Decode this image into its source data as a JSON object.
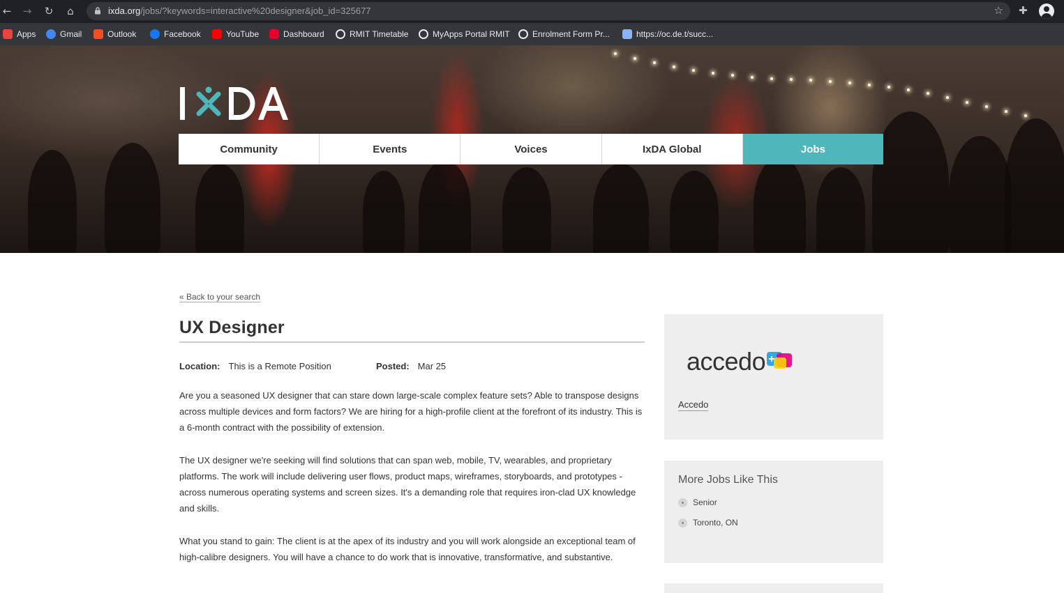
{
  "browser": {
    "url_host": "ixda.org",
    "url_rest": "/jobs/?keywords=interactive%20designer&job_id=325677",
    "bookmarks": [
      {
        "label": "Apps",
        "icon": "apps-grid-icon",
        "color": "#e8453c"
      },
      {
        "label": "Gmail",
        "icon": "google-icon",
        "color": "#4285f4"
      },
      {
        "label": "Outlook",
        "icon": "windows-icon",
        "color": "#f25022"
      },
      {
        "label": "Facebook",
        "icon": "facebook-icon",
        "color": "#1877f2"
      },
      {
        "label": "YouTube",
        "icon": "youtube-icon",
        "color": "#ff0000"
      },
      {
        "label": "Dashboard",
        "icon": "dashboard-icon",
        "color": "#e4002b"
      },
      {
        "label": "RMIT Timetable",
        "icon": "globe-icon",
        "color": "#e8eaed"
      },
      {
        "label": "MyApps Portal RMIT",
        "icon": "globe-icon",
        "color": "#e8eaed"
      },
      {
        "label": "Enrolment Form Pr...",
        "icon": "globe-icon",
        "color": "#e8eaed"
      },
      {
        "label": "https://oc.de.t/succ...",
        "icon": "link-icon",
        "color": "#8ab4f8"
      }
    ]
  },
  "site": {
    "logo_text": "IXDA",
    "accent": "#4fb6bc",
    "nav": [
      {
        "label": "Community",
        "active": false
      },
      {
        "label": "Events",
        "active": false
      },
      {
        "label": "Voices",
        "active": false
      },
      {
        "label": "IxDA Global",
        "active": false
      },
      {
        "label": "Jobs",
        "active": true
      }
    ]
  },
  "job": {
    "back_link": "« Back to your search",
    "title": "UX Designer",
    "location_label": "Location:",
    "location_value": "This is a Remote Position",
    "posted_label": "Posted:",
    "posted_value": "Mar 25",
    "paragraphs": [
      "Are you a seasoned UX designer that can stare down large-scale complex feature sets? Able to transpose designs across multiple devices and form factors? We are hiring for a high-profile client at the forefront of its industry. This is a 6-month contract with the possibility of extension.",
      "The UX designer we're seeking will find solutions that can span web, mobile, TV, wearables, and proprietary platforms. The work will include delivering user flows, product maps, wireframes, storyboards, and prototypes - across numerous operating systems and screen sizes. It's a demanding role that requires iron-clad UX knowledge and skills.",
      "What you stand to gain: The client is at the apex of its industry and you will work alongside an exceptional team of high-calibre designers. You will have a chance to do work that is innovative, transformative, and substantive."
    ]
  },
  "sidebar": {
    "company_logo_text": "accedo",
    "company_name": "Accedo",
    "more_title": "More Jobs Like This",
    "tags": [
      "Senior",
      "Toronto, ON"
    ]
  }
}
